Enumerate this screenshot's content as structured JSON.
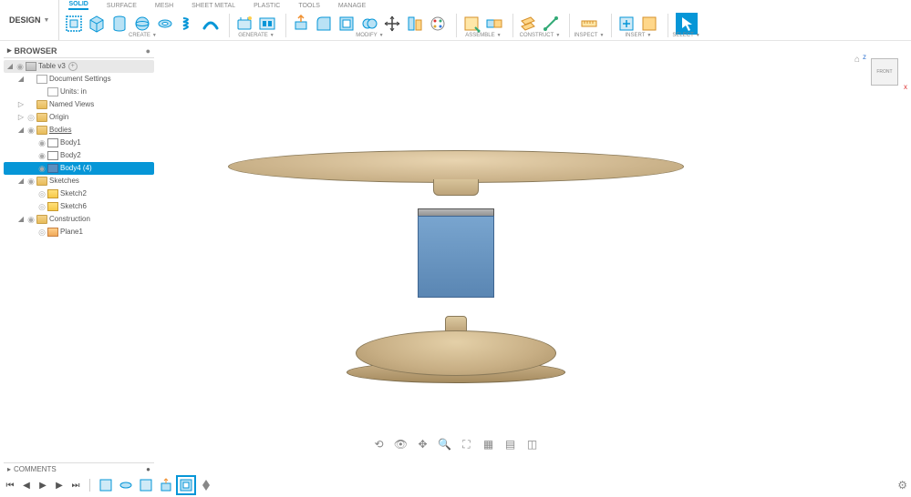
{
  "app": {
    "design_label": "DESIGN"
  },
  "tabs": {
    "solid": "SOLID",
    "surface": "SURFACE",
    "mesh": "MESH",
    "sheet_metal": "SHEET METAL",
    "plastic": "PLASTIC",
    "tools": "TOOLS",
    "manage": "MANAGE"
  },
  "groups": {
    "create": "CREATE",
    "generate": "GENERATE",
    "modify": "MODIFY",
    "assemble": "ASSEMBLE",
    "construct": "CONSTRUCT",
    "inspect": "INSPECT",
    "insert": "INSERT",
    "select": "SELECT"
  },
  "browser": {
    "title": "BROWSER",
    "root": "Table v3",
    "document_settings": "Document Settings",
    "units": "Units: in",
    "named_views": "Named Views",
    "origin": "Origin",
    "bodies": "Bodies",
    "body1": "Body1",
    "body2": "Body2",
    "body4": "Body4 (4)",
    "sketches": "Sketches",
    "sketch2": "Sketch2",
    "sketch6": "Sketch6",
    "construction": "Construction",
    "plane1": "Plane1"
  },
  "comments": {
    "title": "COMMENTS"
  },
  "viewcube": {
    "face": "FRONT"
  }
}
